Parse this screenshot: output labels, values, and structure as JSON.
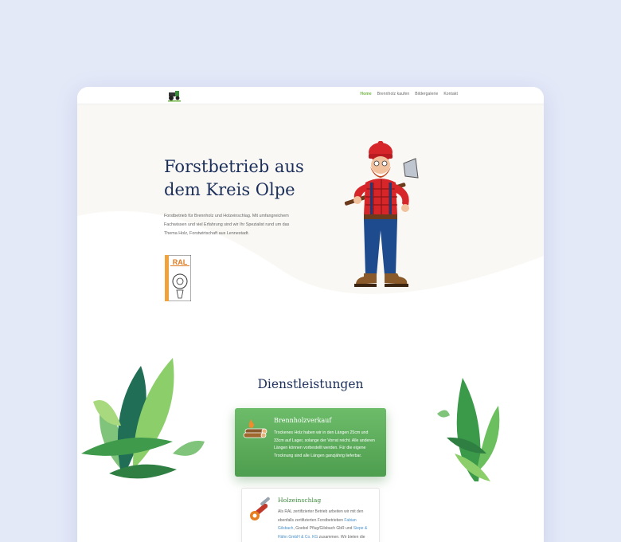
{
  "nav": {
    "logo_icon": "tractor-logo-icon",
    "items": [
      {
        "label": "Home",
        "active": true
      },
      {
        "label": "Brennholz kaufen"
      },
      {
        "label": "Bildergalerie"
      },
      {
        "label": "Kontakt"
      }
    ]
  },
  "hero": {
    "title": "Forstbetrieb aus dem Kreis Olpe",
    "intro": "Forstbetrieb für Brennholz und Holzeinschlag. Mit umfangreichem Fachwissen und viel Erfahrung sind wir Ihr Spezialist rund um das Thema Holz, Forstwirtschaft aus Lennestadt.",
    "badge": {
      "label": "RAL",
      "sublabel": "GÜTEZEICHEN",
      "side_text": "Gemeinsam Qualität ist besser als"
    },
    "illustration": "lumberjack-illustration"
  },
  "services": {
    "heading": "Dienstleistungen",
    "cards": [
      {
        "title": "Brennholzverkauf",
        "icon": "firewood-icon",
        "body": "Trockenes Holz haben wir in den Längen 25cm und 33cm auf Lager, solange der Vorrat reicht. Alle anderen Längen können vorbestellt werden. Für die eigene Trocknung sind alle Längen ganzjährig lieferbar."
      },
      {
        "title": "Holzeinschlag",
        "icon": "chainsaw-icon",
        "body_pre": "Als RAL zertifizierter Betrieb arbeiten wir mit den ebenfalls zertifizierten Forstbetrieben ",
        "link1": "Fabian Gilsbach",
        "body_mid1": ", Goebel Pflug/Gilsbach GbR und ",
        "link2": "Siepe & Hähn GmbH & Co. KG",
        "body_mid2": " zusammen. Wir bieten die"
      }
    ]
  },
  "colors": {
    "accent": "#6db33f",
    "heading": "#1c2f5b",
    "card_green": "#5aad5a",
    "background": "#e4e9f8"
  }
}
